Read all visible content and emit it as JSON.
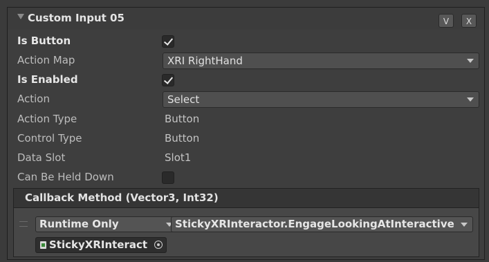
{
  "header": {
    "title": "Custom Input 05",
    "btn_v": "V",
    "btn_x": "X"
  },
  "fields": {
    "is_button": {
      "label": "Is Button",
      "checked": true
    },
    "action_map": {
      "label": "Action Map",
      "value": "XRI RightHand"
    },
    "is_enabled": {
      "label": "Is Enabled",
      "checked": true
    },
    "action": {
      "label": "Action",
      "value": "Select"
    },
    "action_type": {
      "label": "Action Type",
      "value": "Button"
    },
    "control_type": {
      "label": "Control Type",
      "value": "Button"
    },
    "data_slot": {
      "label": "Data Slot",
      "value": "Slot1"
    },
    "can_be_held_down": {
      "label": "Can Be Held Down",
      "checked": false
    }
  },
  "callback": {
    "title": "Callback Method (Vector3, Int32)",
    "runtime_mode": "Runtime Only",
    "method": "StickyXRInteractor.EngageLookingAtInteractive",
    "target_object": "StickyXRInteractor"
  }
}
